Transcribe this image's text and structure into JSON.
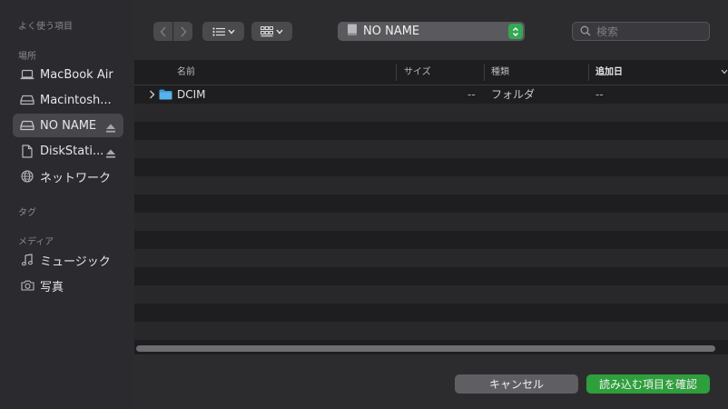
{
  "sidebar": {
    "favorites_header": "よく使う項目",
    "locations_header": "場所",
    "tags_header": "タグ",
    "media_header": "メディア",
    "locations": [
      {
        "label": "MacBook Air",
        "icon": "laptop-icon"
      },
      {
        "label": "Macintosh...",
        "icon": "drive-icon"
      },
      {
        "label": "NO NAME",
        "icon": "drive-icon",
        "selected": true,
        "eject": true
      },
      {
        "label": "DiskStati...",
        "icon": "document-icon",
        "eject": true
      },
      {
        "label": "ネットワーク",
        "icon": "globe-icon"
      }
    ],
    "media": [
      {
        "label": "ミュージック",
        "icon": "music-note-icon"
      },
      {
        "label": "写真",
        "icon": "camera-icon"
      }
    ]
  },
  "toolbar": {
    "location_label": "NO NAME",
    "search_placeholder": "検索"
  },
  "columns": {
    "name": "名前",
    "size": "サイズ",
    "kind": "種類",
    "date_added": "追加日"
  },
  "files": [
    {
      "name": "DCIM",
      "size": "--",
      "kind": "フォルダ",
      "date_added": "--",
      "icon": "folder-icon"
    }
  ],
  "footer": {
    "cancel_label": "キャンセル",
    "open_label": "読み込む項目を確認"
  },
  "colors": {
    "accent_green": "#2f9e3c",
    "folder_blue": "#5ab2ea",
    "sidebar_bg": "#2b2a2e"
  }
}
